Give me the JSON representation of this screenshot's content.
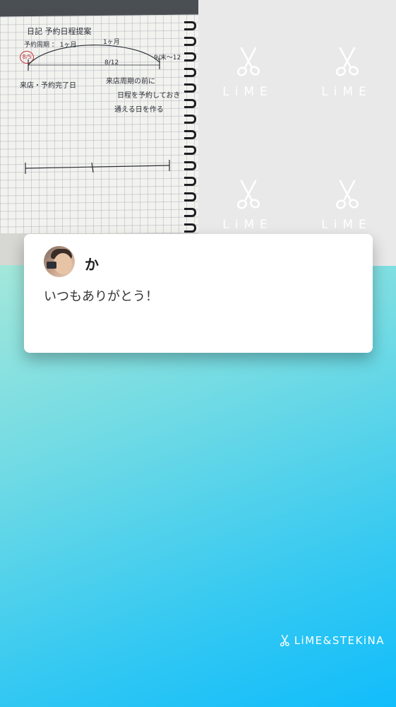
{
  "photo": {
    "notes": {
      "title": "日記 予約日程提案",
      "subtitle": "予約周期 ： 1ヶ月",
      "mid_label": "1ヶ月",
      "date1": "8/12",
      "date2": "9/末〜12",
      "circled": "8/5",
      "left_note": "来店・予約完了日",
      "right_line1": "来店周期の前に",
      "right_line2": "日程を予約しておき",
      "right_line3": "通える日を作る"
    }
  },
  "watermark": {
    "text": "LiME",
    "icon": "scissors-icon"
  },
  "message_card": {
    "avatar_icon": "user-avatar",
    "sender": "か",
    "text": "いつもありがとう！"
  },
  "footer": {
    "brand": "LiME&STEKiNA",
    "brand_icon": "scissors-icon"
  },
  "colors": {
    "gradient_top": "#eaf9cf",
    "gradient_bottom": "#11bdfb",
    "card": "#ffffff",
    "watermark_tile": "#e9e9e9"
  }
}
